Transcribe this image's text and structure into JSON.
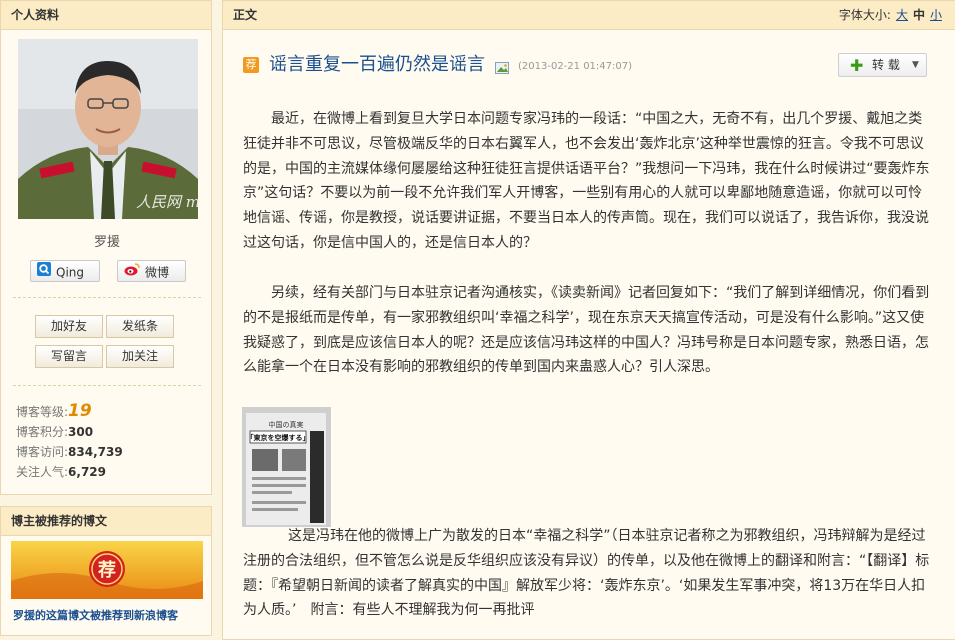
{
  "profile": {
    "header": "个人资料",
    "name": "罗援",
    "watermark": "人民网 military.com",
    "qing_label": "Qing",
    "weibo_label": "微博",
    "actions": [
      "加好友",
      "发纸条",
      "写留言",
      "加关注"
    ],
    "stats": [
      {
        "label": "博客等级:",
        "value": "19"
      },
      {
        "label": "博客积分:",
        "value": "300"
      },
      {
        "label": "博客访问:",
        "value": "834,739"
      },
      {
        "label": "关注人气:",
        "value": "6,729"
      }
    ]
  },
  "recommend": {
    "header": "博主被推荐的博文",
    "badge": "荐",
    "snippet": "罗援的这篇博文被推荐到新浪博客"
  },
  "article": {
    "section_label": "正文",
    "font_size_label": "字体大小:",
    "font_sizes": [
      "大",
      "中",
      "小"
    ],
    "tag": "荐",
    "title": "谣言重复一百遍仍然是谣言",
    "date": "(2013-02-21 01:47:07)",
    "repost_label": "转 载",
    "paragraphs": [
      "最近，在微博上看到复旦大学日本问题专家冯玮的一段话：“中国之大，无奇不有，出几个罗援、戴旭之类狂徒并非不可思议，尽管极端反华的日本右翼军人，也不会发出‘轰炸北京’这种举世震惊的狂言。令我不可思议的是，中国的主流媒体缘何屡屡给这种狂徒狂言提供话语平台？”我想问一下冯玮，我在什么时候讲过“要轰炸东京”这句话？不要以为前一段不允许我们军人开博客，一些别有用心的人就可以卑鄙地随意造谣，你就可以可怜地信谣、传谣，你是教授，说话要讲证据，不要当日本人的传声筒。现在，我们可以说话了，我告诉你，我没说过这句话，你是信中国人的，还是信日本人的？",
      "另续，经有关部门与日本驻京记者沟通核实，《读卖新闻》记者回复如下：“我们了解到详细情况，你们看到的不是报纸而是传单，有一家邪教组织叫‘幸福之科学’，现在东京天天搞宣传活动，可是没有什么影响。”这又使我疑惑了，到底是应该信日本人的呢？还是应该信冯玮这样的中国人？冯玮号称是日本问题专家，熟悉日语，怎么能拿一个在日本没有影响的邪教组织的传单到国内来蛊惑人心？引人深思。",
      "这是冯玮在他的微博上广为散发的日本“幸福之科学”（日本驻京记者称之为邪教组织，冯玮辩解为是经过注册的合法组织，但不管怎么说是反华组织应该没有异议）的传单，以及他在微博上的翻译和附言：“【翻译】标题：『希望朝日新闻的读者了解真实的中国』解放军少将：‘轰炸东京’。‘如果发生军事冲突，将13万在华日人扣为人质。’　附言：有些人不理解我为何一再批评"
    ],
    "photo_headline": "「東京を空爆する」",
    "photo_caption": "中国の真実"
  }
}
